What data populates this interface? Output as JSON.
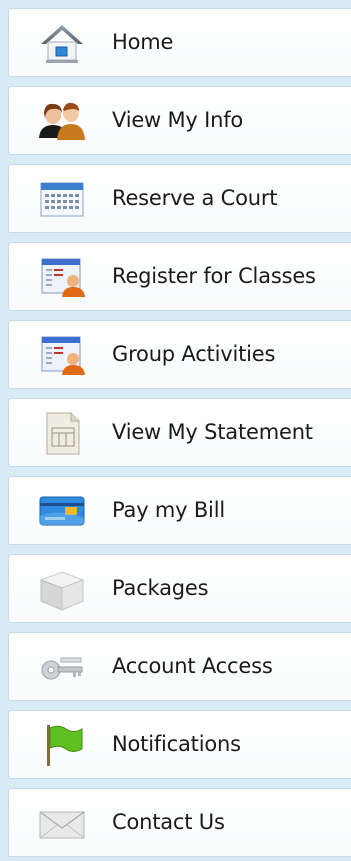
{
  "menu": {
    "items": [
      {
        "label": "Home",
        "icon": "home-icon"
      },
      {
        "label": "View My Info",
        "icon": "people-icon"
      },
      {
        "label": "Reserve a Court",
        "icon": "calendar-icon"
      },
      {
        "label": "Register for Classes",
        "icon": "user-form-icon"
      },
      {
        "label": "Group Activities",
        "icon": "user-form-icon"
      },
      {
        "label": "View My Statement",
        "icon": "statement-icon"
      },
      {
        "label": "Pay my Bill",
        "icon": "credit-card-icon"
      },
      {
        "label": "Packages",
        "icon": "package-box-icon"
      },
      {
        "label": "Account Access",
        "icon": "keys-icon"
      },
      {
        "label": "Notifications",
        "icon": "flag-icon"
      },
      {
        "label": "Contact Us",
        "icon": "envelope-icon"
      }
    ]
  },
  "colors": {
    "background": "#d9ebf5",
    "item_border": "#c4dbe8",
    "text": "#1b1b1b"
  }
}
